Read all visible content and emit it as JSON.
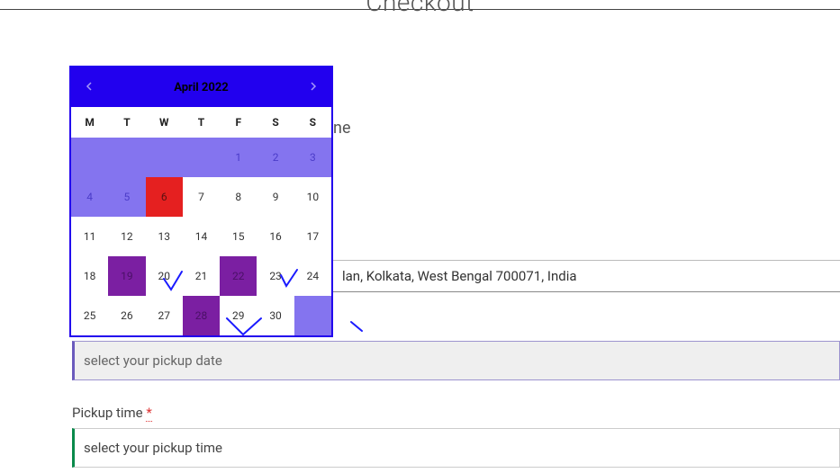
{
  "page": {
    "title": "Checkout"
  },
  "behind": {
    "label_fragment": "ne"
  },
  "address": {
    "value": "lan, Kolkata, West Bengal 700071, India"
  },
  "pickup_date": {
    "placeholder": "select your pickup date"
  },
  "pickup_time": {
    "label": "Pickup time",
    "required_mark": "*",
    "placeholder": "select your pickup time"
  },
  "calendar": {
    "title": "April 2022",
    "dow": [
      "M",
      "T",
      "W",
      "T",
      "F",
      "S",
      "S"
    ],
    "prev_icon": "chevron-left",
    "next_icon": "chevron-right",
    "leading_blanks": 0,
    "cells": [
      {
        "n": "",
        "state": "disabled"
      },
      {
        "n": "",
        "state": "disabled"
      },
      {
        "n": "",
        "state": "disabled"
      },
      {
        "n": "",
        "state": "disabled"
      },
      {
        "n": "1",
        "state": "disabled"
      },
      {
        "n": "2",
        "state": "disabled"
      },
      {
        "n": "3",
        "state": "disabled"
      },
      {
        "n": "4",
        "state": "disabled"
      },
      {
        "n": "5",
        "state": "disabled"
      },
      {
        "n": "6",
        "state": "today"
      },
      {
        "n": "7",
        "state": "open"
      },
      {
        "n": "8",
        "state": "open"
      },
      {
        "n": "9",
        "state": "open"
      },
      {
        "n": "10",
        "state": "open"
      },
      {
        "n": "11",
        "state": "open"
      },
      {
        "n": "12",
        "state": "open"
      },
      {
        "n": "13",
        "state": "open"
      },
      {
        "n": "14",
        "state": "open"
      },
      {
        "n": "15",
        "state": "open"
      },
      {
        "n": "16",
        "state": "open"
      },
      {
        "n": "17",
        "state": "open"
      },
      {
        "n": "18",
        "state": "open"
      },
      {
        "n": "19",
        "state": "highlight"
      },
      {
        "n": "20",
        "state": "open"
      },
      {
        "n": "21",
        "state": "open"
      },
      {
        "n": "22",
        "state": "highlight"
      },
      {
        "n": "23",
        "state": "open"
      },
      {
        "n": "24",
        "state": "open"
      },
      {
        "n": "25",
        "state": "open"
      },
      {
        "n": "26",
        "state": "open"
      },
      {
        "n": "27",
        "state": "open"
      },
      {
        "n": "28",
        "state": "highlight"
      },
      {
        "n": "29",
        "state": "open"
      },
      {
        "n": "30",
        "state": "open"
      },
      {
        "n": "",
        "state": "disabled"
      }
    ]
  }
}
